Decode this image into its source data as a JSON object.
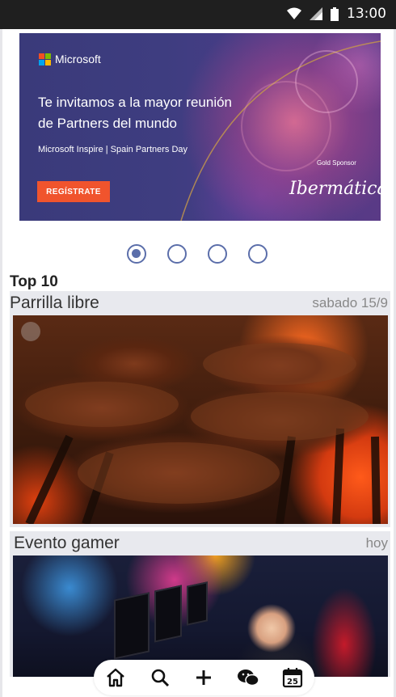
{
  "status_bar": {
    "time": "13:00",
    "icons": [
      "wifi-icon",
      "signal-icon",
      "battery-icon"
    ]
  },
  "banner": {
    "brand": "Microsoft",
    "headline_line1": "Te invitamos a la mayor reunión",
    "headline_line2": "de Partners del mundo",
    "subline": "Microsoft Inspire | Spain Partners Day",
    "cta_label": "REGÍSTRATE",
    "sponsor_caption": "Gold Sponsor",
    "sponsor_name": "Ibermática",
    "colors": {
      "cta": "#f0542d",
      "background": "#3e3d80"
    }
  },
  "carousel": {
    "count": 4,
    "active_index": 0
  },
  "section": {
    "title": "Top 10"
  },
  "events": [
    {
      "title": "Parrilla libre",
      "date": "sabado 15/9",
      "image": "grilled-steaks-photo"
    },
    {
      "title": "Evento gamer",
      "date": "hoy",
      "image": "gaming-event-photo"
    }
  ],
  "bottom_nav": {
    "items": [
      {
        "icon": "home-icon"
      },
      {
        "icon": "search-icon"
      },
      {
        "icon": "plus-icon"
      },
      {
        "icon": "chat-icon"
      },
      {
        "icon": "calendar-icon",
        "badge": "25"
      }
    ]
  }
}
